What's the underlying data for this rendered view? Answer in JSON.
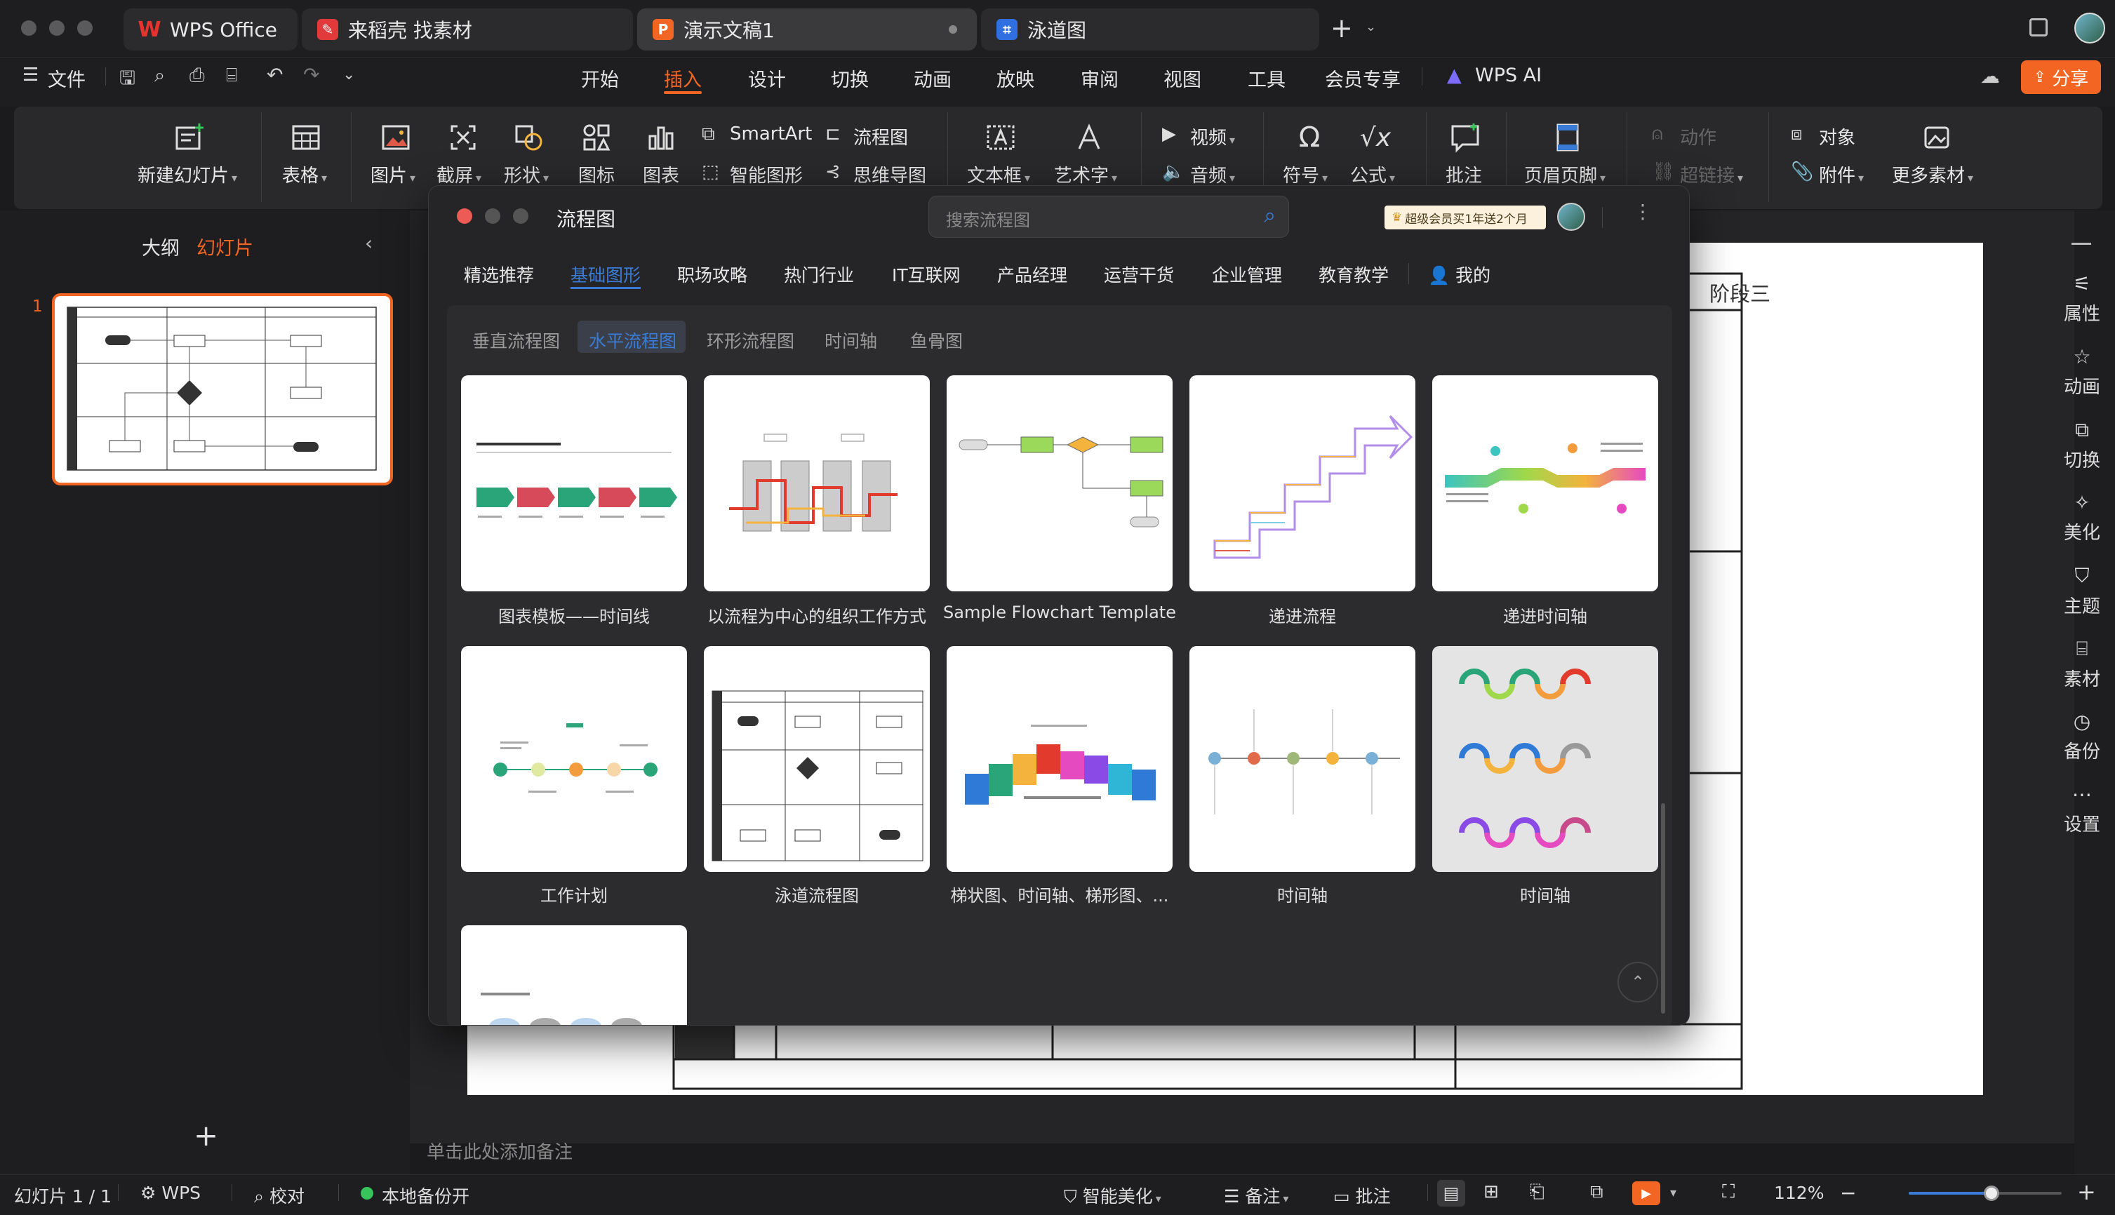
{
  "window": {
    "tabs": [
      {
        "label": "WPS Office",
        "icon": "wps-logo-icon"
      },
      {
        "label": "来稻壳 找素材",
        "icon": "docer-icon"
      },
      {
        "label": "演示文稿1",
        "icon": "presentation-icon"
      },
      {
        "label": "泳道图",
        "icon": "flowchart-doc-icon"
      }
    ],
    "new_tab_symbol": "+"
  },
  "menu": {
    "file_label": "文件",
    "tabs": [
      "开始",
      "插入",
      "设计",
      "切换",
      "动画",
      "放映",
      "审阅",
      "视图",
      "工具",
      "会员专享"
    ],
    "active_tab": "插入",
    "ai_label": "WPS AI",
    "share_label": "分享"
  },
  "ribbon": {
    "new_slide": "新建幻灯片",
    "table": "表格",
    "picture": "图片",
    "screenshot": "截屏",
    "shape": "形状",
    "icon": "图标",
    "chart": "图表",
    "smartart": "SmartArt",
    "flowchart": "流程图",
    "smart_shape": "智能图形",
    "mindmap": "思维导图",
    "textbox": "文本框",
    "wordart": "艺术字",
    "video": "视频",
    "audio": "音频",
    "symbol": "符号",
    "formula": "公式",
    "comment": "批注",
    "header_footer": "页眉页脚",
    "action": "动作",
    "hyperlink": "超链接",
    "object": "对象",
    "attachment": "附件",
    "more_material": "更多素材"
  },
  "left_panel": {
    "tabs": [
      "大纲",
      "幻灯片"
    ],
    "active_tab": "幻灯片",
    "slide_number": "1",
    "add_symbol": "+"
  },
  "slide": {
    "stage_label": "阶段三"
  },
  "notes_placeholder": "单击此处添加备注",
  "right_panel": [
    "属性",
    "动画",
    "切换",
    "美化",
    "主题",
    "素材",
    "备份",
    "设置"
  ],
  "dialog": {
    "title": "流程图",
    "search_placeholder": "搜索流程图",
    "vip_banner": "超级会员买1年送2个月",
    "categories": [
      "精选推荐",
      "基础图形",
      "职场攻略",
      "热门行业",
      "IT互联网",
      "产品经理",
      "运营干货",
      "企业管理",
      "教育教学",
      "我的"
    ],
    "active_category": "基础图形",
    "subcategories": [
      "垂直流程图",
      "水平流程图",
      "环形流程图",
      "时间轴",
      "鱼骨图"
    ],
    "active_subcategory": "水平流程图",
    "templates_row1": [
      "图表模板——时间线",
      "以流程为中心的组织工作方式",
      "Sample Flowchart Template",
      "递进流程",
      "递进时间轴"
    ],
    "templates_row2": [
      "工作计划",
      "泳道流程图",
      "梯状图、时间轴、梯形图、...",
      "时间轴",
      "时间轴"
    ],
    "scroll_top_symbol": "⌃"
  },
  "status": {
    "slide_count": "幻灯片 1 / 1",
    "wps": "WPS",
    "proofread": "校对",
    "backup": "本地备份开",
    "smart_beautify": "智能美化",
    "notes": "备注",
    "comment": "批注",
    "zoom": "112%",
    "zoom_fraction": 0.54
  },
  "colors": {
    "accent": "#f26522",
    "dialog_accent": "#3a7bd5",
    "vip": "#e8c37a",
    "backup_dot": "#37c45a"
  }
}
